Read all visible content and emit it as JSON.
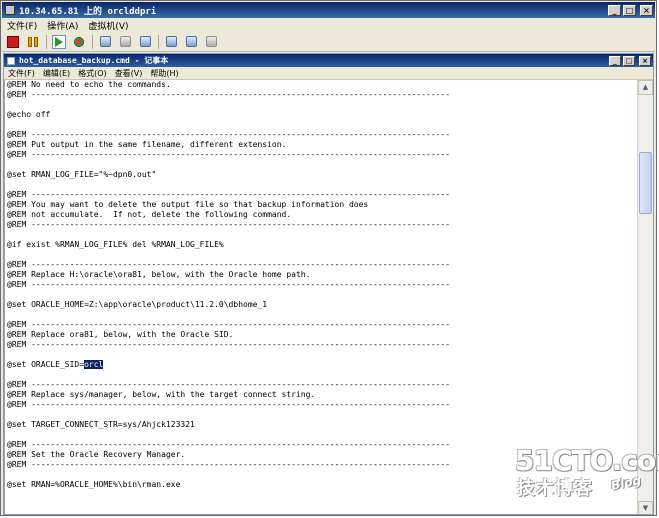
{
  "vm_window": {
    "title": "10.34.65.81 上的 orclddpri",
    "menu": [
      "文件(F)",
      "操作(A)",
      "虚拟机(V)"
    ],
    "toolbar_icons": [
      "stop-icon",
      "pause-icon",
      "play-icon",
      "reset-icon",
      "snapshot-icon",
      "revert-icon",
      "snapshot-manager-icon",
      "ctrl-alt-del-icon",
      "settings-icon",
      "undo-icon"
    ],
    "window_buttons": {
      "minimize": "_",
      "maximize": "□",
      "close": "×"
    }
  },
  "notepad": {
    "title": "hot_database_backup.cmd - 记事本",
    "menu": [
      "文件(F)",
      "编辑(E)",
      "格式(O)",
      "查看(V)",
      "帮助(H)"
    ],
    "window_buttons": {
      "minimize": "_",
      "maximize": "□",
      "close": "×"
    },
    "lines": [
      "@REM No need to echo the commands.",
      "@REM ---------------------------------------------------------------------------------------",
      "",
      "@echo off",
      "",
      "@REM ---------------------------------------------------------------------------------------",
      "@REM Put output in the same filename, different extension.",
      "@REM ---------------------------------------------------------------------------------------",
      "",
      "@set RMAN_LOG_FILE=\"%~dpn0.out\"",
      "",
      "@REM ---------------------------------------------------------------------------------------",
      "@REM You may want to delete the output file so that backup information does",
      "@REM not accumulate.  If not, delete the following command.",
      "@REM ---------------------------------------------------------------------------------------",
      "",
      "@if exist %RMAN_LOG_FILE% del %RMAN_LOG_FILE%",
      "",
      "@REM ---------------------------------------------------------------------------------------",
      "@REM Replace H:\\oracle\\ora81, below, with the Oracle home path.",
      "@REM ---------------------------------------------------------------------------------------",
      "",
      "@set ORACLE_HOME=Z:\\app\\oracle\\product\\11.2.0\\dbhome_1",
      "",
      "@REM ---------------------------------------------------------------------------------------",
      "@REM Replace ora81, below, with the Oracle SID.",
      "@REM ---------------------------------------------------------------------------------------",
      "",
      "@set ORACLE_SID=",
      "",
      "@REM ---------------------------------------------------------------------------------------",
      "@REM Replace sys/manager, below, with the target connect string.",
      "@REM ---------------------------------------------------------------------------------------",
      "",
      "@set TARGET_CONNECT_STR=sys/Ahjck123321",
      "",
      "@REM ---------------------------------------------------------------------------------------",
      "@REM Set the Oracle Recovery Manager.",
      "@REM ---------------------------------------------------------------------------------------",
      "",
      "@set RMAN=%ORACLE_HOME%\\bin\\rman.exe",
      ""
    ],
    "selection": {
      "line_index": 28,
      "text": "orcl"
    }
  },
  "watermark": {
    "main": "51CTO.com",
    "sub": "技术博客",
    "blog": "Blog"
  }
}
